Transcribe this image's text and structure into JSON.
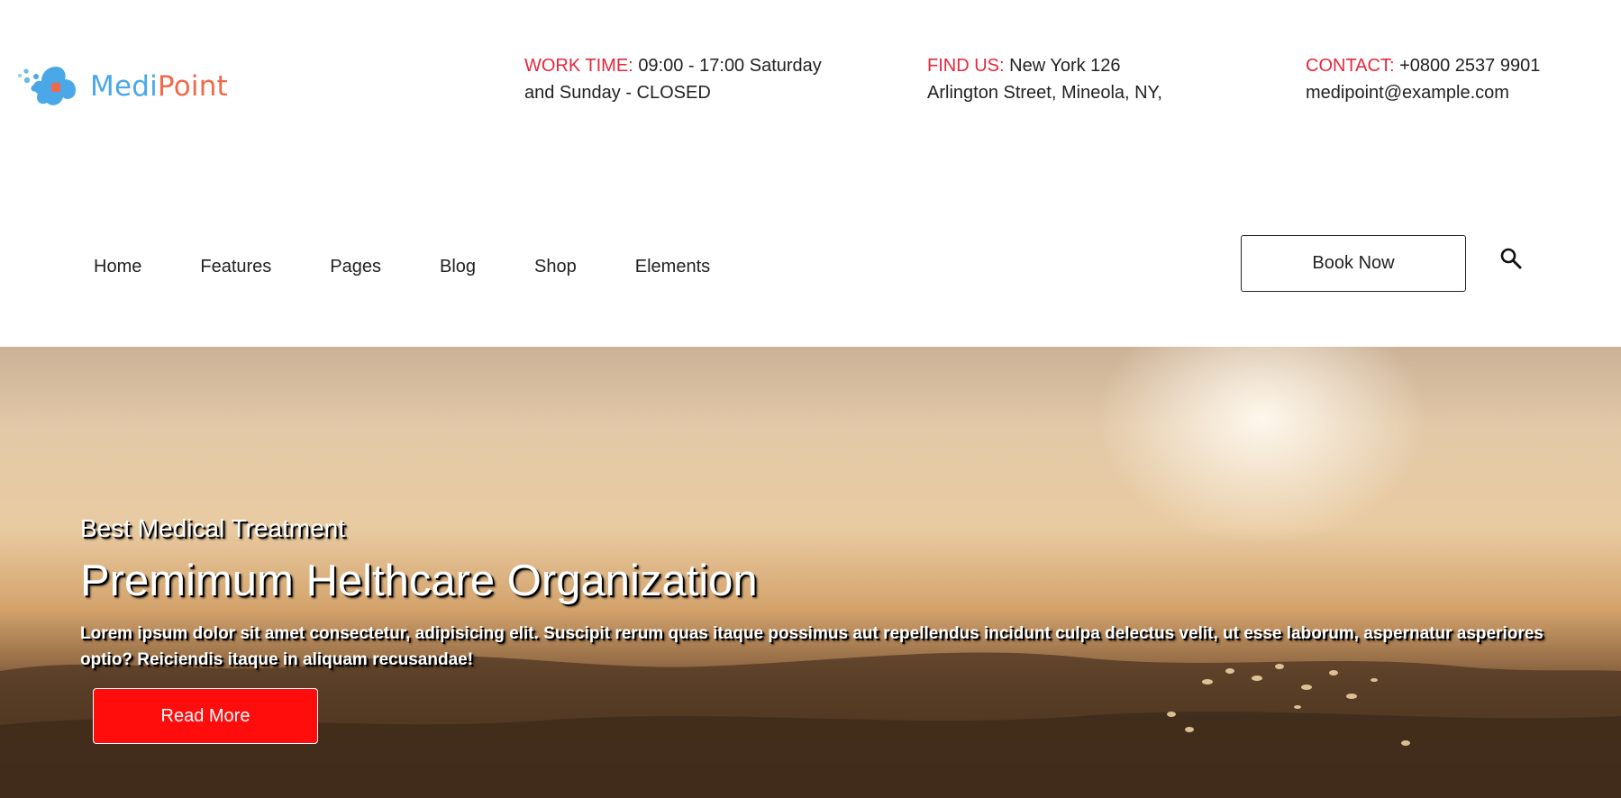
{
  "logo": {
    "part1": "Medi",
    "part2": "Point",
    "colors": {
      "medi": "#4aa8e8",
      "point": "#f06a4a"
    }
  },
  "info": {
    "work": {
      "label": "WORK TIME:",
      "line1": "09:00 - 17:00 Saturday",
      "line2": "and Sunday - CLOSED"
    },
    "find": {
      "label": "FIND US:",
      "line1": "New York 126",
      "line2": "Arlington Street, Mineola, NY,"
    },
    "contact": {
      "label": "CONTACT:",
      "line1": "+0800 2537 9901",
      "line2": "medipoint@example.com"
    }
  },
  "nav": {
    "items": [
      "Home",
      "Features",
      "Pages",
      "Blog",
      "Shop",
      "Elements"
    ],
    "book_label": "Book Now",
    "search_icon": "search-icon"
  },
  "hero": {
    "subtitle": "Best Medical Treatment",
    "title": "Premimum Helthcare Organization",
    "description": "Lorem ipsum dolor sit amet consectetur, adipisicing elit. Suscipit rerum quas itaque possimus aut repellendus incidunt culpa delectus velit, ut esse laborum, aspernatur asperiores optio? Reiciendis itaque in aliquam recusandae!",
    "button_label": "Read More",
    "button_color": "#ff0d0d"
  },
  "colors": {
    "accent_red": "#e5273a"
  }
}
